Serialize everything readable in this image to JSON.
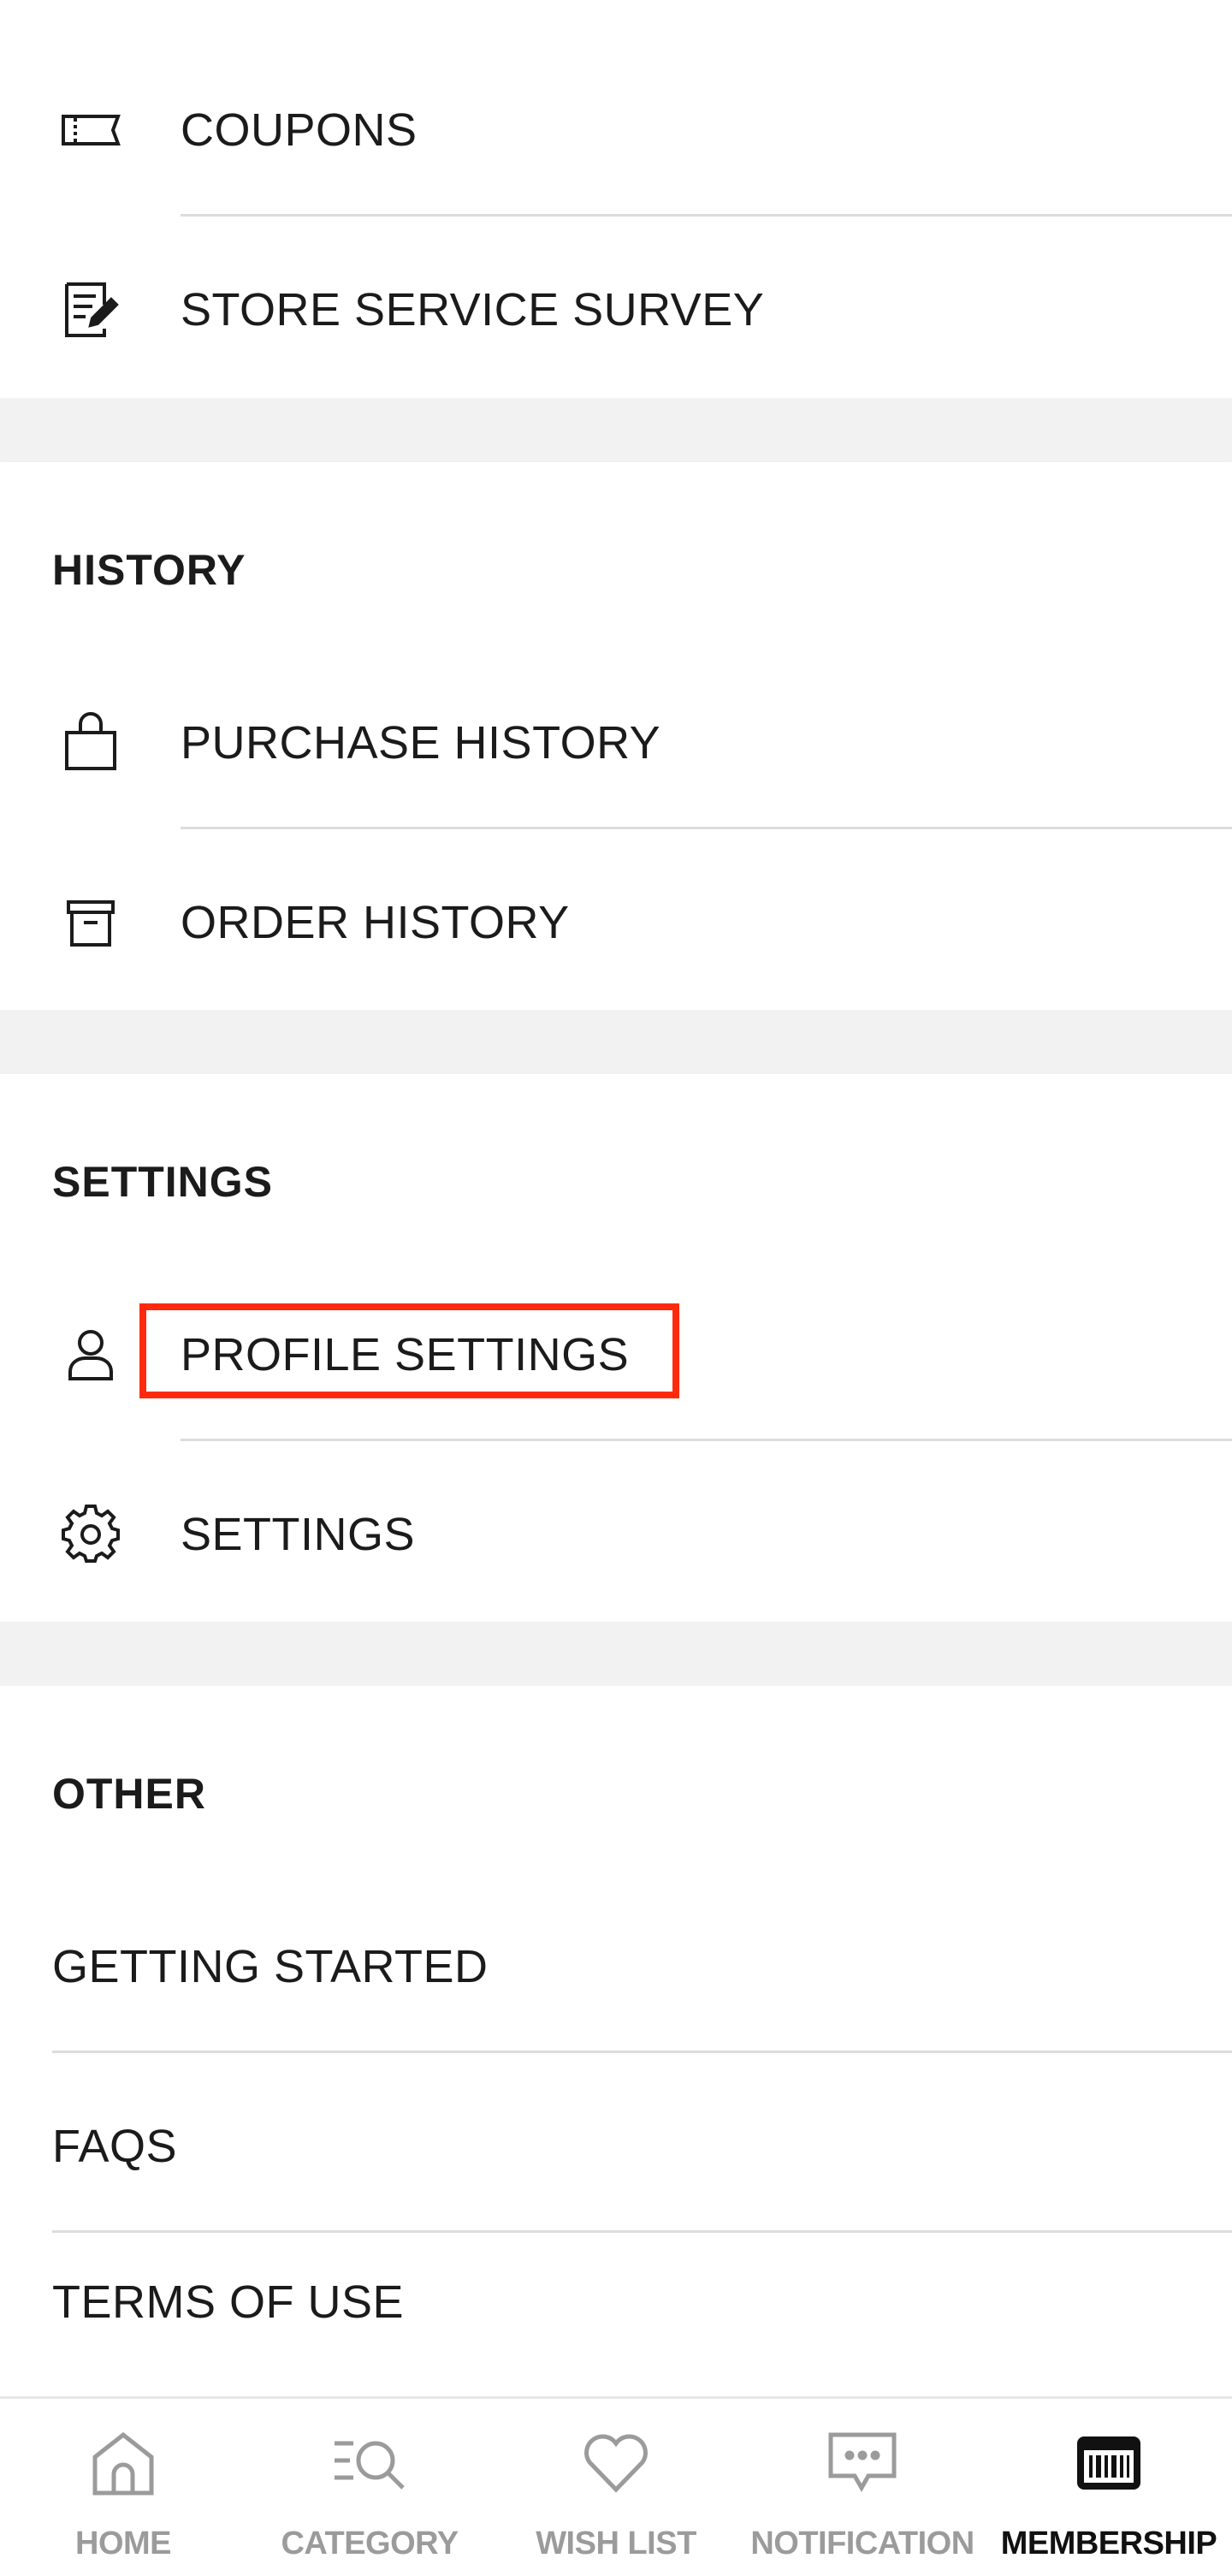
{
  "account": {
    "items": [
      {
        "label": "COUPONS",
        "icon": "ticket-icon"
      },
      {
        "label": "STORE SERVICE SURVEY",
        "icon": "survey-edit-icon"
      }
    ]
  },
  "history": {
    "heading": "HISTORY",
    "items": [
      {
        "label": "PURCHASE HISTORY",
        "icon": "shopping-bag-icon"
      },
      {
        "label": "ORDER HISTORY",
        "icon": "box-icon"
      }
    ]
  },
  "settings": {
    "heading": "SETTINGS",
    "items": [
      {
        "label": "PROFILE SETTINGS",
        "icon": "person-icon"
      },
      {
        "label": "SETTINGS",
        "icon": "gear-icon"
      }
    ]
  },
  "other": {
    "heading": "OTHER",
    "items": [
      {
        "label": "GETTING STARTED"
      },
      {
        "label": "FAQS"
      },
      {
        "label": "TERMS OF USE"
      }
    ]
  },
  "bottom_nav": {
    "items": [
      {
        "label": "HOME",
        "icon": "home-icon",
        "active": false
      },
      {
        "label": "CATEGORY",
        "icon": "category-search-icon",
        "active": false
      },
      {
        "label": "WISH LIST",
        "icon": "heart-icon",
        "active": false
      },
      {
        "label": "NOTIFICATION",
        "icon": "chat-bubble-icon",
        "active": false
      },
      {
        "label": "MEMBERSHIP",
        "icon": "membership-card-icon",
        "active": true
      }
    ]
  },
  "colors": {
    "highlight": "#ff2a0e",
    "inactive_nav": "#9b9b9b",
    "section_gap": "#f2f2f2"
  }
}
